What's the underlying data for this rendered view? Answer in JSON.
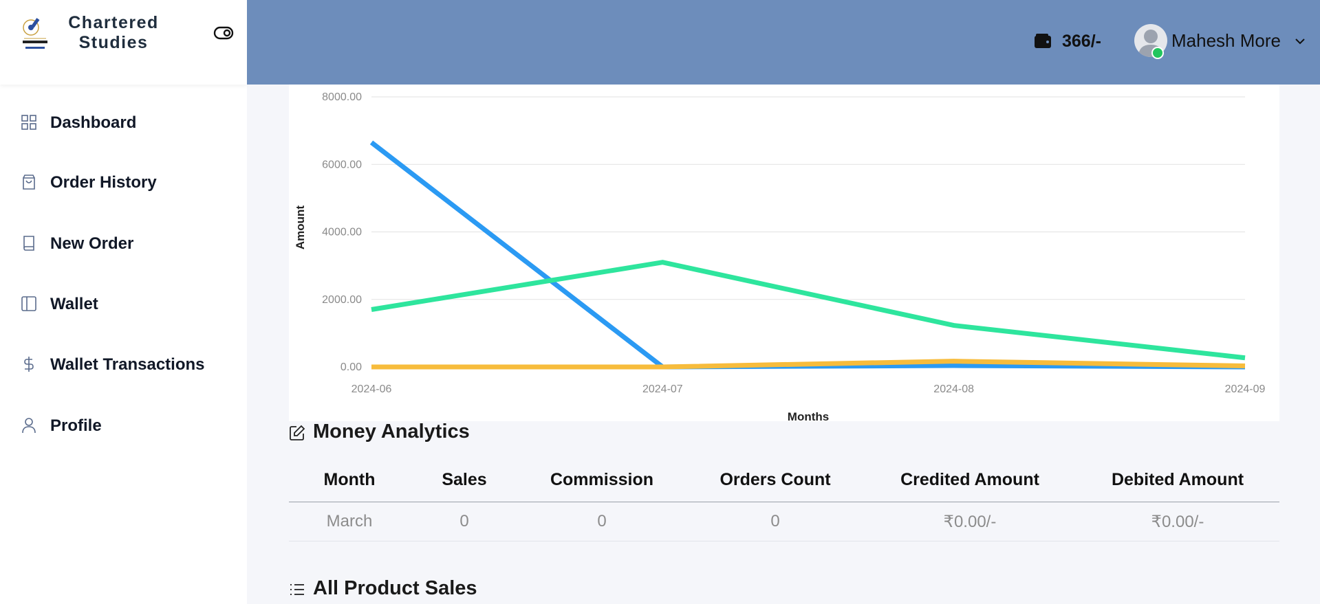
{
  "brand": {
    "name_line1": "Chartered",
    "name_line2": "Studies"
  },
  "sidebar": {
    "items": [
      {
        "label": "Dashboard",
        "icon": "grid-icon"
      },
      {
        "label": "Order History",
        "icon": "shopping-bag-icon"
      },
      {
        "label": "New Order",
        "icon": "book-icon"
      },
      {
        "label": "Wallet",
        "icon": "sidebar-panel-icon"
      },
      {
        "label": "Wallet Transactions",
        "icon": "dollar-icon"
      },
      {
        "label": "Profile",
        "icon": "user-icon"
      }
    ]
  },
  "header": {
    "wallet_amount": "366/-",
    "user_name": "Mahesh More",
    "color": "#6d8dbb"
  },
  "chart_data": {
    "type": "line",
    "categories": [
      "2024-06",
      "2024-07",
      "2024-08",
      "2024-09"
    ],
    "series": [
      {
        "color": "#2b9af3",
        "values": [
          6650,
          0,
          40,
          0
        ]
      },
      {
        "color": "#2ee59d",
        "values": [
          1700,
          3100,
          1230,
          270
        ]
      },
      {
        "color": "#f7bc3c",
        "values": [
          0,
          0,
          170,
          30
        ]
      }
    ],
    "xlabel": "Months",
    "ylabel": "Amount",
    "yticks": [
      "0.00",
      "2000.00",
      "4000.00",
      "6000.00",
      "8000.00"
    ],
    "ylim": [
      0,
      8000
    ],
    "grid": true
  },
  "money_analytics": {
    "title": "Money Analytics",
    "columns": [
      "Month",
      "Sales",
      "Commission",
      "Orders Count",
      "Credited Amount",
      "Debited Amount"
    ],
    "rows": [
      [
        "March",
        "0",
        "0",
        "0",
        "₹0.00/-",
        "₹0.00/-"
      ]
    ]
  },
  "all_product_sales": {
    "title": "All Product Sales"
  }
}
